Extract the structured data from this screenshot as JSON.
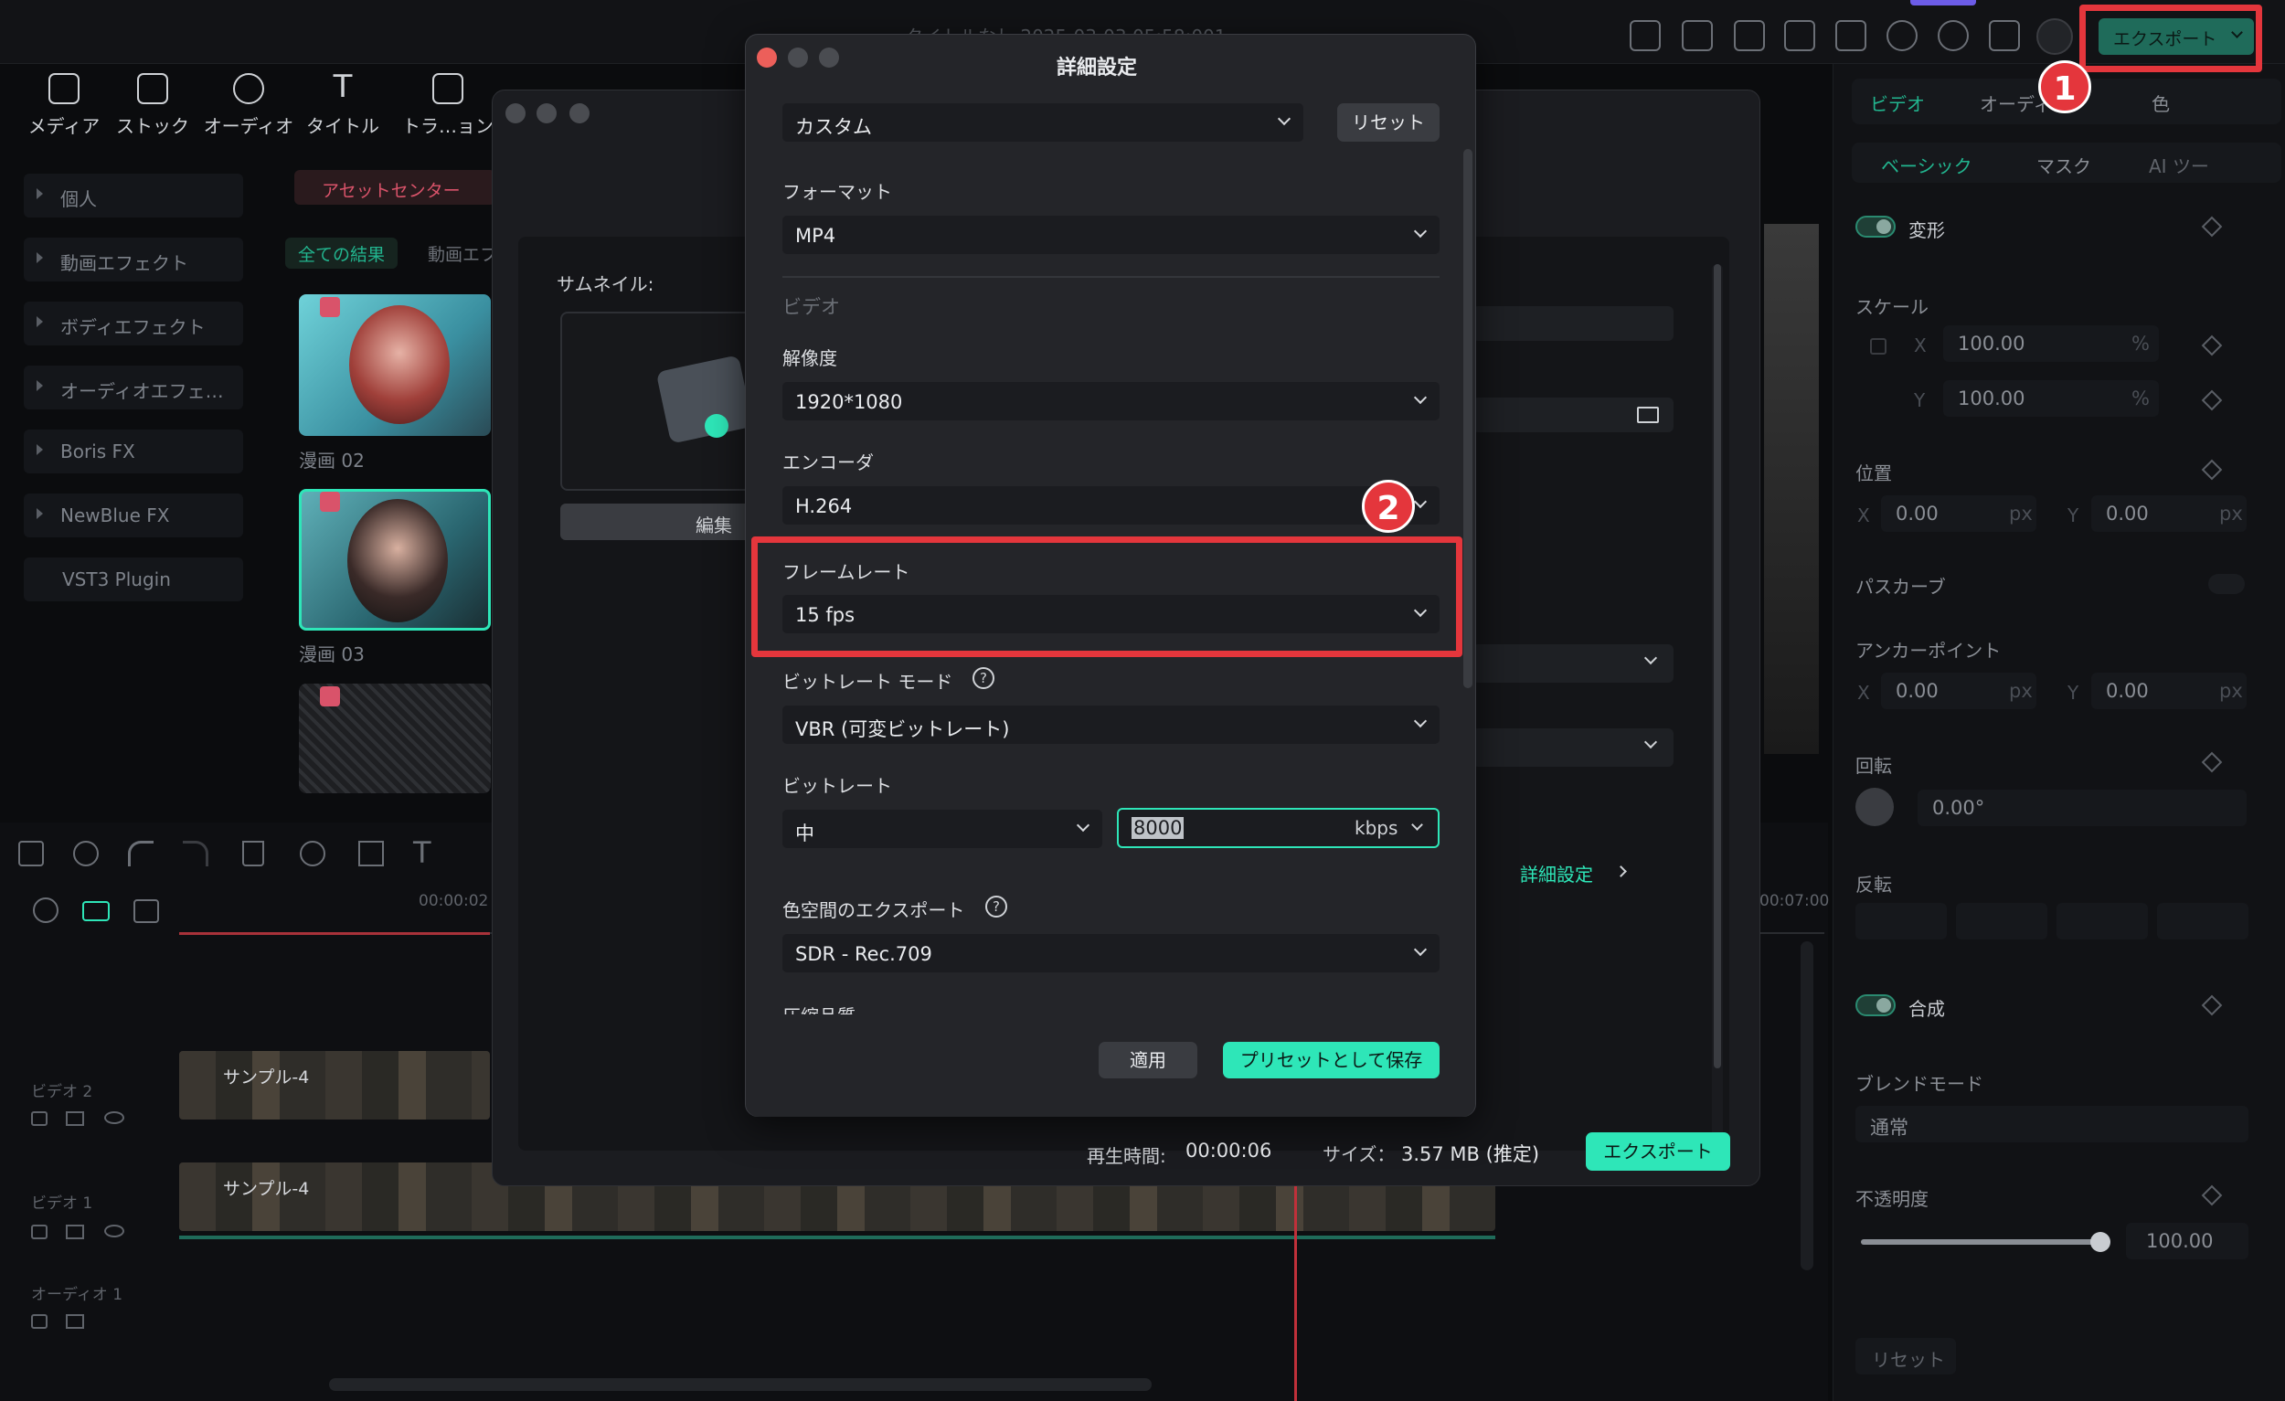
{
  "topbar": {
    "title": "タイトルなし 2025-03-03 05:58:001",
    "export_label": "エクスポート"
  },
  "media_toolbar": {
    "items": [
      {
        "label": "メディア",
        "icon": "media-icon"
      },
      {
        "label": "ストック",
        "icon": "stock-icon"
      },
      {
        "label": "オーディオ",
        "icon": "music-note-icon"
      },
      {
        "label": "タイトル",
        "icon": "title-t-icon"
      },
      {
        "label": "トラ…ョン",
        "icon": "transition-icon"
      }
    ]
  },
  "sidebar": {
    "items": [
      "個人",
      "動画エフェクト",
      "ボディエフェクト",
      "オーディオエフェ…",
      "Boris FX",
      "NewBlue FX",
      "VST3 Plugin"
    ]
  },
  "browser": {
    "asset_center": "アセットセンター",
    "filters": [
      "全ての結果",
      "動画エフ"
    ],
    "thumbs": [
      {
        "caption": "漫画 02"
      },
      {
        "caption": "漫画 03"
      },
      {
        "caption": ""
      }
    ]
  },
  "timeline": {
    "timecode": "00:00:02",
    "timecode_right": "00:07:00",
    "tracks": [
      {
        "label": "ビデオ 2",
        "clip": "サンプル-4"
      },
      {
        "label": "ビデオ 1",
        "clip": "サンプル-4"
      },
      {
        "label": "オーディオ 1",
        "clip": ""
      }
    ]
  },
  "right_panel": {
    "tabs": [
      "ビデオ",
      "オーディオ",
      "色"
    ],
    "subtabs": [
      "ベーシック",
      "マスク",
      "AI ツー"
    ],
    "transform": "変形",
    "scale": "スケール",
    "scale_x": "100.00",
    "scale_y": "100.00",
    "percent": "%",
    "position": "位置",
    "pos_x": "0.00",
    "pos_y": "0.00",
    "px": "px",
    "path_curve": "パスカーブ",
    "anchor": "アンカーポイント",
    "anchor_x": "0.00",
    "anchor_y": "0.00",
    "rotation": "回転",
    "rotation_val": "0.00°",
    "flip": "反転",
    "composite": "合成",
    "blend_mode": "ブレンドモード",
    "blend_val": "通常",
    "opacity": "不透明度",
    "opacity_val": "100.00",
    "opacity_fraction": 1.0,
    "reset": "リセット",
    "x": "X",
    "y": "Y"
  },
  "export_window": {
    "thumbnail_label": "サムネイル:",
    "edit_label": "編集",
    "advanced_link": "詳細設定",
    "duration_label": "再生時間:",
    "duration": "00:00:06",
    "size_label": "サイズ：",
    "size": "3.57 MB (推定)",
    "export_button": "エクスポート"
  },
  "dialog": {
    "title": "詳細設定",
    "preset": "カスタム",
    "reset": "リセット",
    "format_label": "フォーマット",
    "format": "MP4",
    "video_section": "ビデオ",
    "resolution_label": "解像度",
    "resolution": "1920*1080",
    "encoder_label": "エンコーダ",
    "encoder": "H.264",
    "framerate_label": "フレームレート",
    "framerate": "15 fps",
    "bitrate_mode_label": "ビットレート モード",
    "bitrate_mode": "VBR (可変ビットレート)",
    "bitrate_label": "ビットレート",
    "bitrate_level": "中",
    "bitrate_value": "8000",
    "bitrate_unit": "kbps",
    "colorspace_label": "色空間のエクスポート",
    "colorspace": "SDR - Rec.709",
    "compression_label": "圧縮品質",
    "apply": "適用",
    "save_preset": "プリセットとして保存"
  },
  "annotations": {
    "badge1": "1",
    "badge2": "2"
  },
  "colors": {
    "accent": "#2ee6b8",
    "annotation": "#e4363c"
  }
}
